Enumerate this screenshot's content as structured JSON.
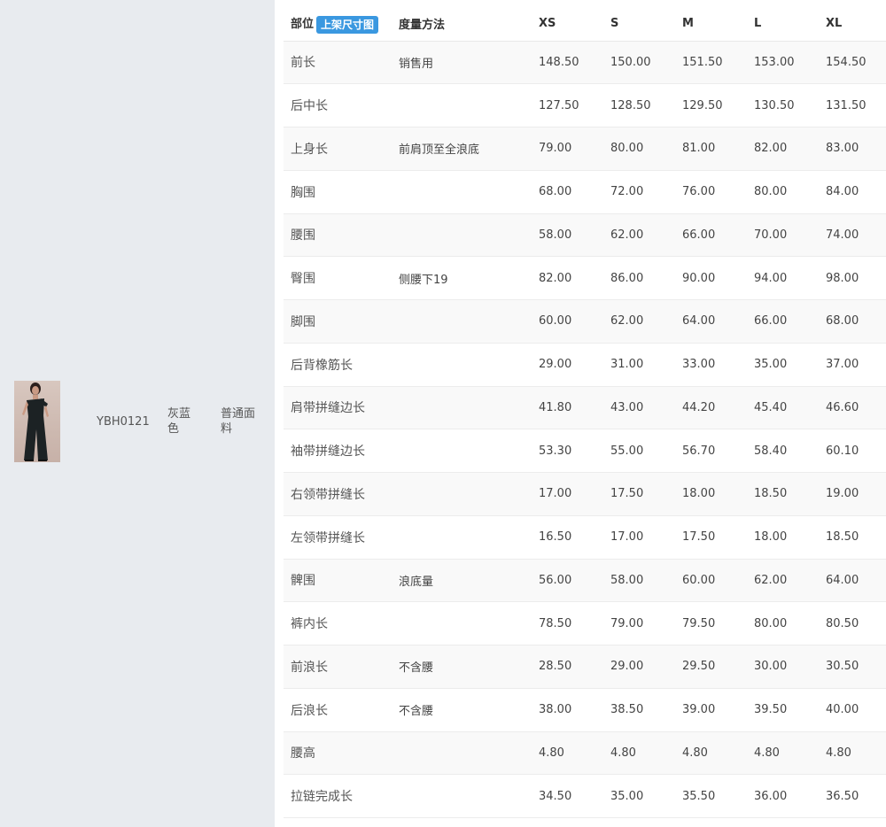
{
  "product": {
    "sku": "YBH0121",
    "color": "灰蓝色",
    "fabric": "普通面料"
  },
  "table": {
    "headers": {
      "part": "部位",
      "tag_button": "上架尺寸图",
      "method": "度量方法",
      "sizes": [
        "XS",
        "S",
        "M",
        "L",
        "XL"
      ]
    },
    "rows": [
      {
        "part": "前长",
        "method": "销售用",
        "values": [
          "148.50",
          "150.00",
          "151.50",
          "153.00",
          "154.50"
        ]
      },
      {
        "part": "后中长",
        "method": "",
        "values": [
          "127.50",
          "128.50",
          "129.50",
          "130.50",
          "131.50"
        ]
      },
      {
        "part": "上身长",
        "method": "前肩顶至全浪底",
        "values": [
          "79.00",
          "80.00",
          "81.00",
          "82.00",
          "83.00"
        ]
      },
      {
        "part": "胸围",
        "method": "",
        "values": [
          "68.00",
          "72.00",
          "76.00",
          "80.00",
          "84.00"
        ]
      },
      {
        "part": "腰围",
        "method": "",
        "values": [
          "58.00",
          "62.00",
          "66.00",
          "70.00",
          "74.00"
        ]
      },
      {
        "part": "臀围",
        "method": "侧腰下19",
        "values": [
          "82.00",
          "86.00",
          "90.00",
          "94.00",
          "98.00"
        ]
      },
      {
        "part": "脚围",
        "method": "",
        "values": [
          "60.00",
          "62.00",
          "64.00",
          "66.00",
          "68.00"
        ]
      },
      {
        "part": "后背橡筋长",
        "method": "",
        "values": [
          "29.00",
          "31.00",
          "33.00",
          "35.00",
          "37.00"
        ]
      },
      {
        "part": "肩带拼缝边长",
        "method": "",
        "values": [
          "41.80",
          "43.00",
          "44.20",
          "45.40",
          "46.60"
        ]
      },
      {
        "part": "袖带拼缝边长",
        "method": "",
        "values": [
          "53.30",
          "55.00",
          "56.70",
          "58.40",
          "60.10"
        ]
      },
      {
        "part": "右领带拼缝长",
        "method": "",
        "values": [
          "17.00",
          "17.50",
          "18.00",
          "18.50",
          "19.00"
        ]
      },
      {
        "part": "左领带拼缝长",
        "method": "",
        "values": [
          "16.50",
          "17.00",
          "17.50",
          "18.00",
          "18.50"
        ]
      },
      {
        "part": "髀围",
        "method": "浪底量",
        "values": [
          "56.00",
          "58.00",
          "60.00",
          "62.00",
          "64.00"
        ]
      },
      {
        "part": "裤内长",
        "method": "",
        "values": [
          "78.50",
          "79.00",
          "79.50",
          "80.00",
          "80.50"
        ]
      },
      {
        "part": "前浪长",
        "method": "不含腰",
        "values": [
          "28.50",
          "29.00",
          "29.50",
          "30.00",
          "30.50"
        ]
      },
      {
        "part": "后浪长",
        "method": "不含腰",
        "values": [
          "38.00",
          "38.50",
          "39.00",
          "39.50",
          "40.00"
        ]
      },
      {
        "part": "腰高",
        "method": "",
        "values": [
          "4.80",
          "4.80",
          "4.80",
          "4.80",
          "4.80"
        ]
      },
      {
        "part": "拉链完成长",
        "method": "",
        "values": [
          "34.50",
          "35.00",
          "35.50",
          "36.00",
          "36.50"
        ]
      }
    ]
  },
  "colors": {
    "left_panel_bg": "#e8ebef",
    "tag_button_bg": "#3a98e0",
    "row_stripe": "#f9f9f9"
  }
}
